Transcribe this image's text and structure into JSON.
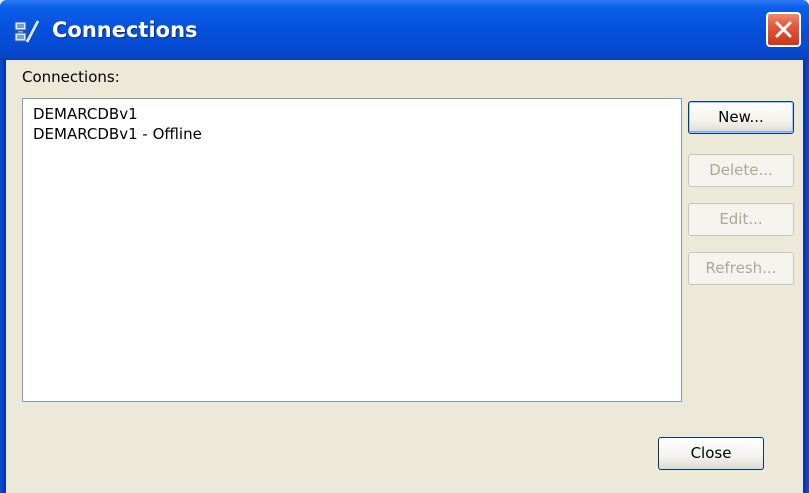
{
  "window": {
    "title": "Connections",
    "close_icon": "close-icon",
    "title_icon": "connections-icon"
  },
  "content": {
    "list_label": "Connections:",
    "items": [
      {
        "label": "DEMARCDBv1"
      },
      {
        "label": "DEMARCDBv1 - Offline"
      }
    ]
  },
  "buttons": {
    "new": {
      "label": "New...",
      "enabled": true
    },
    "delete": {
      "label": "Delete...",
      "enabled": false
    },
    "edit": {
      "label": "Edit...",
      "enabled": false
    },
    "refresh": {
      "label": "Refresh...",
      "enabled": false
    },
    "close": {
      "label": "Close",
      "enabled": true
    }
  },
  "colors": {
    "titlebar": "#0550dc",
    "dialog_bg": "#ece9d8",
    "close_button": "#e2573a"
  }
}
